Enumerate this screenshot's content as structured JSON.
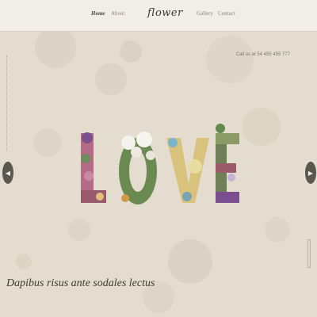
{
  "nav": {
    "items": [
      {
        "label": "Home",
        "active": true
      },
      {
        "label": "About",
        "active": false
      },
      {
        "label": "Gallery",
        "active": false
      },
      {
        "label": "Contact",
        "active": false
      }
    ],
    "logo": "flower"
  },
  "hero": {
    "contact_text": "Call us at 54 455 455 777",
    "word": "LOVE",
    "caption": "Dapibus risus ante sodales lectus",
    "prev_icon": "chevron-left-icon",
    "next_icon": "chevron-right-icon"
  },
  "colors": {
    "topbar": "#f1eee8",
    "hero_background": "#e3dccf",
    "text": "#4a443c",
    "arrow": "#5a5650"
  }
}
